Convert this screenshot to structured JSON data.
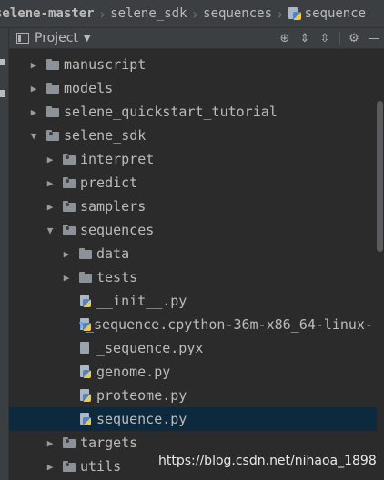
{
  "breadcrumb": {
    "items": [
      "selene-master",
      "selene_sdk",
      "sequences",
      "sequence"
    ]
  },
  "project": {
    "title": "Project",
    "tools": {
      "locate": "target-icon",
      "expand": "expand-all-icon",
      "collapse": "collapse-all-icon",
      "settings": "gear-icon",
      "hide": "minimize-icon"
    }
  },
  "tree": [
    {
      "label": "manuscript",
      "depth": 1,
      "kind": "folder",
      "expanded": false
    },
    {
      "label": "models",
      "depth": 1,
      "kind": "folder",
      "expanded": false
    },
    {
      "label": "selene_quickstart_tutorial",
      "depth": 1,
      "kind": "folder",
      "expanded": false
    },
    {
      "label": "selene_sdk",
      "depth": 1,
      "kind": "package",
      "expanded": true
    },
    {
      "label": "interpret",
      "depth": 2,
      "kind": "package",
      "expanded": false
    },
    {
      "label": "predict",
      "depth": 2,
      "kind": "package",
      "expanded": false
    },
    {
      "label": "samplers",
      "depth": 2,
      "kind": "package",
      "expanded": false
    },
    {
      "label": "sequences",
      "depth": 2,
      "kind": "package",
      "expanded": true
    },
    {
      "label": "data",
      "depth": 3,
      "kind": "folder",
      "expanded": false
    },
    {
      "label": "tests",
      "depth": 3,
      "kind": "folder",
      "expanded": false
    },
    {
      "label": "__init__.py",
      "depth": 3,
      "kind": "py"
    },
    {
      "label": "_sequence.cpython-36m-x86_64-linux-",
      "depth": 3,
      "kind": "so"
    },
    {
      "label": "_sequence.pyx",
      "depth": 3,
      "kind": "text"
    },
    {
      "label": "genome.py",
      "depth": 3,
      "kind": "py"
    },
    {
      "label": "proteome.py",
      "depth": 3,
      "kind": "py"
    },
    {
      "label": "sequence.py",
      "depth": 3,
      "kind": "py",
      "selected": true
    },
    {
      "label": "targets",
      "depth": 2,
      "kind": "package",
      "expanded": false
    },
    {
      "label": "utils",
      "depth": 2,
      "kind": "package",
      "expanded": false
    }
  ],
  "watermark": "https://blog.csdn.net/nihaoa_1898"
}
